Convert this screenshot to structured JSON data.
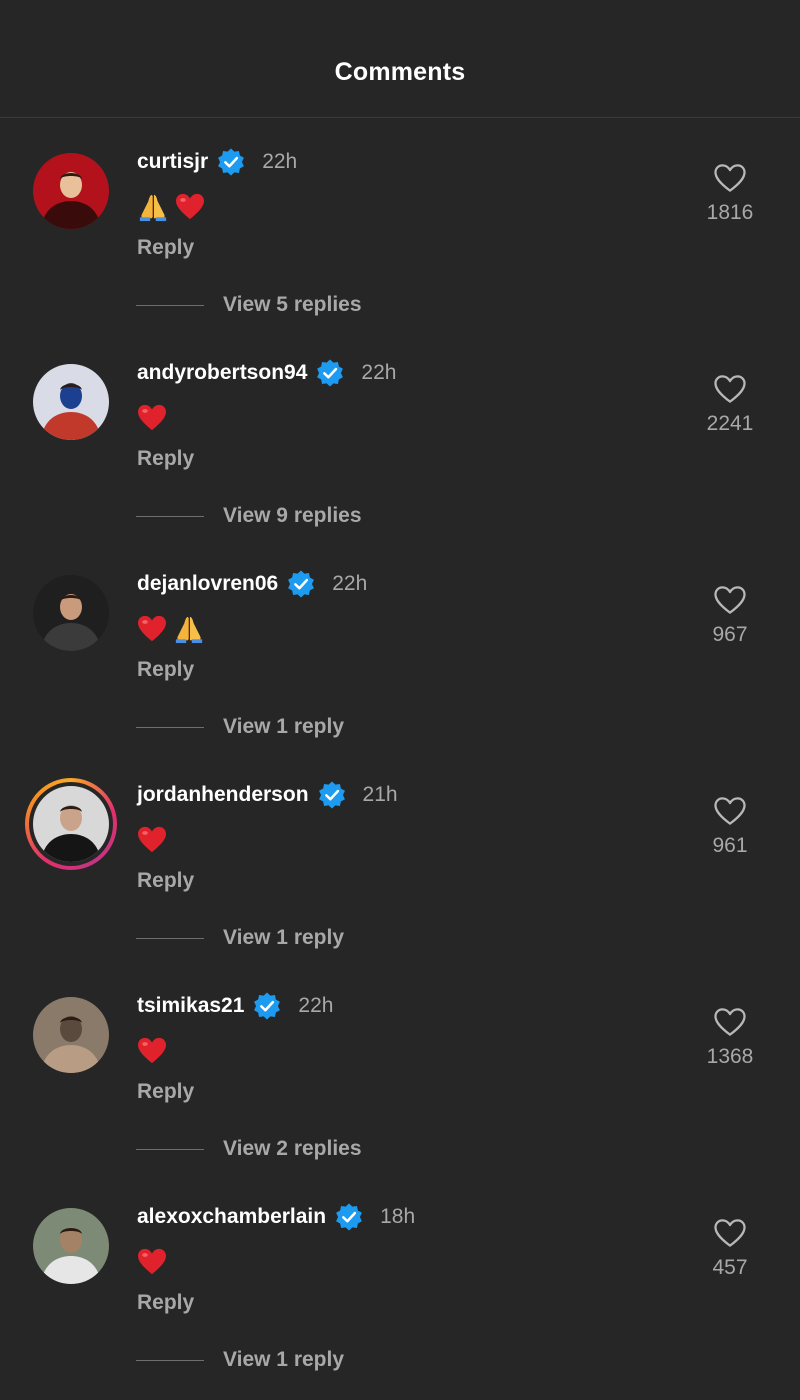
{
  "header": {
    "title": "Comments"
  },
  "comments": [
    {
      "username": "curtisjr",
      "time": "22h",
      "emojis": [
        "pray",
        "heart"
      ],
      "reply_label": "Reply",
      "view_replies": "View 5 replies",
      "likes": "1816",
      "story_ring": false,
      "avatar_colors": [
        "#b3121c",
        "#3a0b0b",
        "#e8c19a"
      ]
    },
    {
      "username": "andyrobertson94",
      "time": "22h",
      "emojis": [
        "heart"
      ],
      "reply_label": "Reply",
      "view_replies": "View 9 replies",
      "likes": "2241",
      "story_ring": false,
      "avatar_colors": [
        "#d9dce6",
        "#c0392b",
        "#1d3f8f"
      ]
    },
    {
      "username": "dejanlovren06",
      "time": "22h",
      "emojis": [
        "heart",
        "pray"
      ],
      "reply_label": "Reply",
      "view_replies": "View 1 reply",
      "likes": "967",
      "story_ring": false,
      "avatar_colors": [
        "#1f1f1f",
        "#3b3b3b",
        "#c99a7c"
      ]
    },
    {
      "username": "jordanhenderson",
      "time": "21h",
      "emojis": [
        "heart"
      ],
      "reply_label": "Reply",
      "view_replies": "View 1 reply",
      "likes": "961",
      "story_ring": true,
      "avatar_colors": [
        "#d8d8d8",
        "#151515",
        "#c9a48a"
      ]
    },
    {
      "username": "tsimikas21",
      "time": "22h",
      "emojis": [
        "heart"
      ],
      "reply_label": "Reply",
      "view_replies": "View 2 replies",
      "likes": "1368",
      "story_ring": false,
      "avatar_colors": [
        "#8a7a6a",
        "#b89c84",
        "#5a4a3e"
      ]
    },
    {
      "username": "alexoxchamberlain",
      "time": "18h",
      "emojis": [
        "heart"
      ],
      "reply_label": "Reply",
      "view_replies": "View 1 reply",
      "likes": "457",
      "story_ring": false,
      "avatar_colors": [
        "#7c8a76",
        "#e6e6e6",
        "#a38266"
      ]
    }
  ],
  "colors": {
    "background": "#262626",
    "verified": "#1d9bf0",
    "heart": "#e0222c",
    "secondary_text": "#a8a8a8"
  }
}
